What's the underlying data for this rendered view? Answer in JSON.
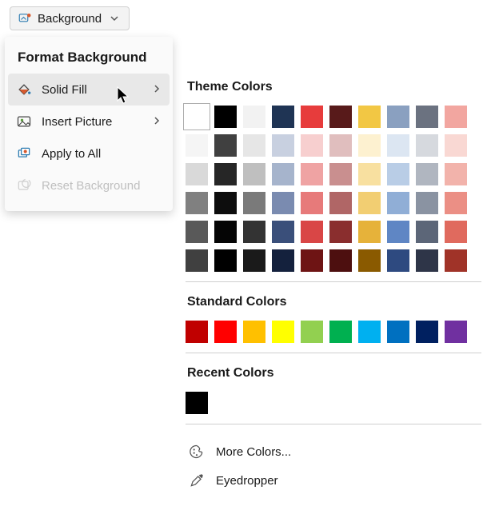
{
  "topbar": {
    "label": "Background"
  },
  "menu": {
    "title": "Format Background",
    "items": [
      {
        "label": "Solid Fill",
        "submenu": true,
        "highlighted": true,
        "icon": "bucket-icon",
        "disabled": false
      },
      {
        "label": "Insert Picture",
        "submenu": true,
        "highlighted": false,
        "icon": "picture-icon",
        "disabled": false
      },
      {
        "label": "Apply to All",
        "submenu": false,
        "highlighted": false,
        "icon": "apply-all-icon",
        "disabled": false
      },
      {
        "label": "Reset Background",
        "submenu": false,
        "highlighted": false,
        "icon": "reset-icon",
        "disabled": true
      }
    ]
  },
  "colors": {
    "theme_title": "Theme Colors",
    "theme_grid": [
      [
        "#ffffff",
        "#000000",
        "#f2f2f2",
        "#1f3454",
        "#e73c3c",
        "#581a1a",
        "#f2c744",
        "#8aa0c0",
        "#6b7280",
        "#f2a6a0"
      ],
      [
        "#f5f5f5",
        "#404040",
        "#e6e6e6",
        "#c8d0e0",
        "#f7cfcf",
        "#e0bebe",
        "#fdf1d0",
        "#dce6f2",
        "#d6d9de",
        "#f9d8d3"
      ],
      [
        "#d9d9d9",
        "#262626",
        "#bfbfbf",
        "#a6b4cc",
        "#efa3a3",
        "#c98f8f",
        "#f8e0a0",
        "#b9cde6",
        "#b0b6c0",
        "#f2b3ab"
      ],
      [
        "#808080",
        "#0d0d0d",
        "#7a7a7a",
        "#7a8bb0",
        "#e77a7a",
        "#b06666",
        "#f2ce72",
        "#90aed6",
        "#8a93a2",
        "#eb8f85"
      ],
      [
        "#595959",
        "#050505",
        "#333333",
        "#3a4f7a",
        "#d94646",
        "#8a2e2e",
        "#e6b23a",
        "#5f86c4",
        "#5c6678",
        "#e06a5e"
      ],
      [
        "#404040",
        "#000000",
        "#1a1a1a",
        "#14213d",
        "#6e1414",
        "#4d0f0f",
        "#8a5a00",
        "#2e4a80",
        "#2e3548",
        "#a03328"
      ]
    ],
    "theme_selected": [
      0,
      0
    ],
    "standard_title": "Standard Colors",
    "standard": [
      "#c00000",
      "#ff0000",
      "#ffc000",
      "#ffff00",
      "#92d050",
      "#00b050",
      "#00b0f0",
      "#0070c0",
      "#002060",
      "#7030a0"
    ],
    "recent_title": "Recent Colors",
    "recent": [
      "#000000"
    ],
    "more_label": "More Colors...",
    "eyedropper_label": "Eyedropper"
  }
}
